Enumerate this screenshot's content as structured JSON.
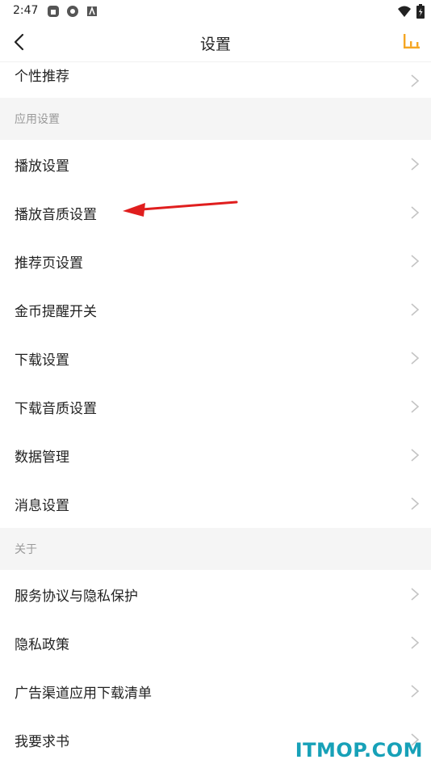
{
  "status_bar": {
    "time": "2:47"
  },
  "nav": {
    "title": "设置"
  },
  "rows": {
    "recommend": "个性推荐"
  },
  "sections": {
    "app_settings": {
      "title": "应用设置",
      "items": [
        "播放设置",
        "播放音质设置",
        "推荐页设置",
        "金币提醒开关",
        "下载设置",
        "下载音质设置",
        "数据管理",
        "消息设置"
      ]
    },
    "about": {
      "title": "关于",
      "items": [
        "服务协议与隐私保护",
        "隐私政策",
        "广告渠道应用下载清单",
        "我要求书"
      ]
    }
  },
  "watermark": "ITMOP.COM",
  "colors": {
    "accent": "#f5a623",
    "section_bg": "#f5f5f5",
    "annotation_arrow": "#e01e1e",
    "watermark": "#17a1b8"
  },
  "icons": {
    "back": "chevron-left-icon",
    "nav_right": "bar-chart-icon",
    "row": "chevron-right-icon"
  }
}
